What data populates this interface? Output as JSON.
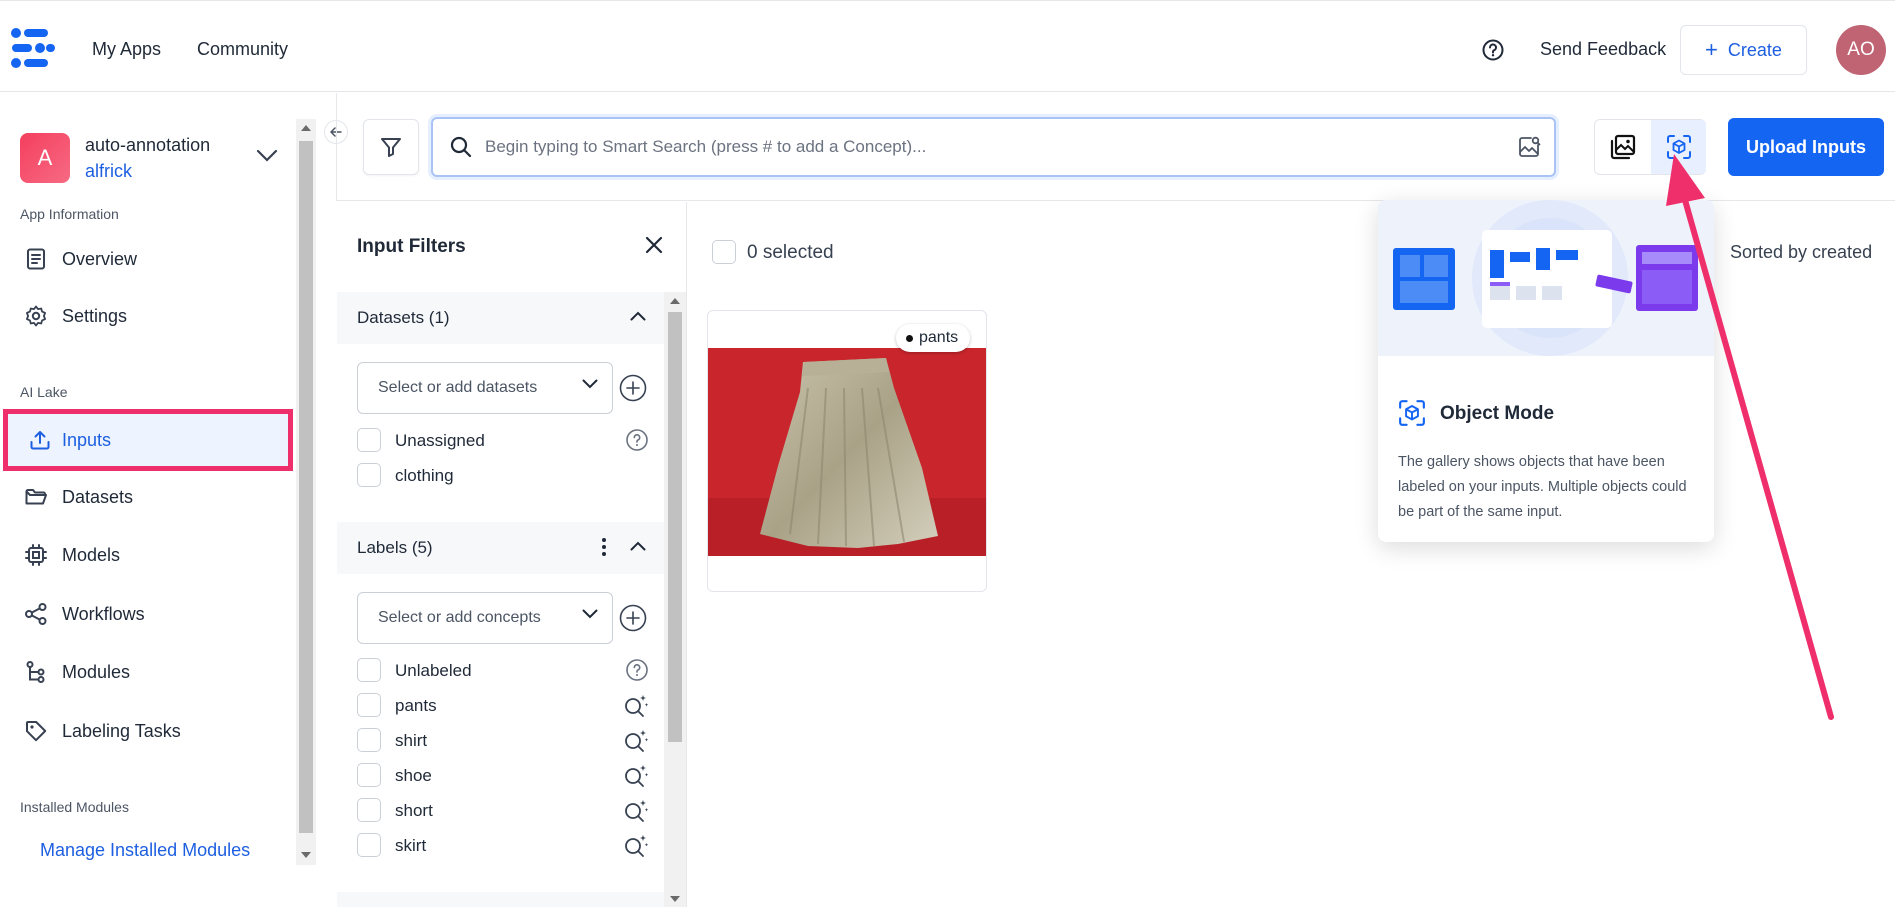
{
  "topbar": {
    "my_apps": "My Apps",
    "community": "Community",
    "send_feedback": "Send Feedback",
    "create": "Create",
    "avatar_initials": "AO"
  },
  "app": {
    "badge": "A",
    "name": "auto-annotation",
    "owner": "alfrick"
  },
  "sidebar": {
    "app_info_label": "App Information",
    "overview": "Overview",
    "settings": "Settings",
    "ai_lake_label": "AI Lake",
    "inputs": "Inputs",
    "datasets": "Datasets",
    "models": "Models",
    "workflows": "Workflows",
    "modules": "Modules",
    "labeling_tasks": "Labeling Tasks",
    "installed_modules_label": "Installed Modules",
    "manage_installed_modules": "Manage Installed Modules"
  },
  "search": {
    "placeholder": "Begin typing to Smart Search (press # to add a Concept)..."
  },
  "upload_inputs": "Upload Inputs",
  "filters": {
    "title": "Input Filters",
    "datasets_section": "Datasets (1)",
    "datasets_placeholder": "Select or add datasets",
    "datasets": [
      "Unassigned",
      "clothing"
    ],
    "labels_section": "Labels (5)",
    "concepts_placeholder": "Select or add concepts",
    "labels": [
      "Unlabeled",
      "pants",
      "shirt",
      "shoe",
      "short",
      "skirt"
    ]
  },
  "gallery": {
    "selected": "0 selected",
    "sorted": "Sorted by created",
    "card_label": "pants"
  },
  "popover": {
    "title": "Object Mode",
    "description": "The gallery shows objects that have been labeled on your inputs. Multiple objects could be part of the same input."
  },
  "colors": {
    "brand_blue": "#1565f3",
    "highlight_pink": "#ef2f6b",
    "avatar": "#c06474"
  }
}
